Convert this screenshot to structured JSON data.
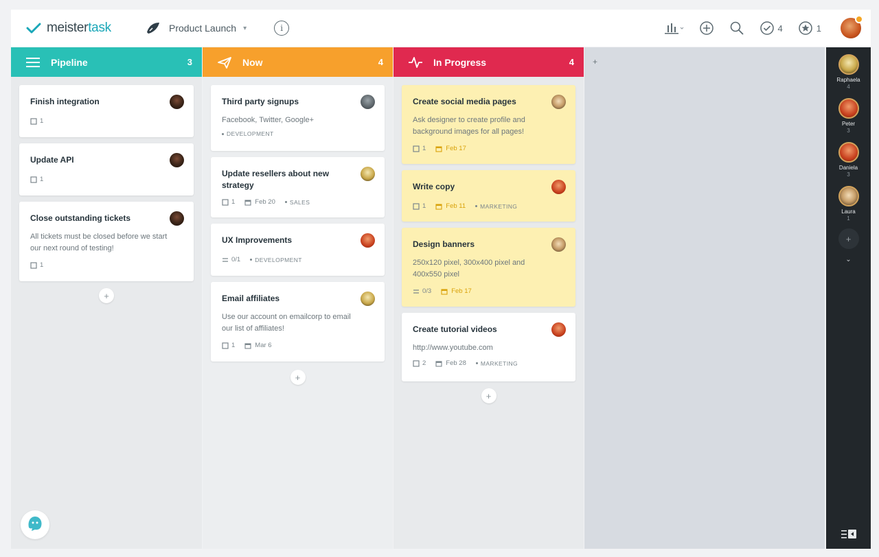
{
  "app": {
    "logo_text_1": "meister",
    "logo_text_2": "task",
    "project_name": "Product Launch",
    "info_icon": "i"
  },
  "topbar": {
    "chart_icon": "bar-chart-icon",
    "add_icon": "plus-circle-icon",
    "search_icon": "search-icon",
    "tasks_count": "4",
    "stars_count": "1"
  },
  "colors": {
    "pipeline": "#29c0b6",
    "now": "#f7a02c",
    "in_progress": "#e0294f",
    "due_date": "#d9a20a"
  },
  "columns": {
    "pipeline": {
      "title": "Pipeline",
      "count": "3",
      "cards": [
        {
          "title": "Finish integration",
          "checklist": "1"
        },
        {
          "title": "Update API",
          "checklist": "1"
        },
        {
          "title": "Close outstanding tickets",
          "desc": "All tickets must be closed before we start our next round of testing!",
          "checklist": "1"
        }
      ]
    },
    "now": {
      "title": "Now",
      "count": "4",
      "cards": [
        {
          "title": "Third party signups",
          "desc": "Facebook, Twitter, Google+",
          "tag": "DEVELOPMENT"
        },
        {
          "title": "Update resellers about new strategy",
          "checklist": "1",
          "date": "Feb 20",
          "tag": "SALES"
        },
        {
          "title": "UX Improvements",
          "checklist": "0/1",
          "tag": "DEVELOPMENT"
        },
        {
          "title": "Email affiliates",
          "desc": "Use our account on emailcorp to email our list of affiliates!",
          "checklist": "1",
          "date": "Mar 6"
        }
      ]
    },
    "in_progress": {
      "title": "In Progress",
      "count": "4",
      "cards": [
        {
          "title": "Create social media pages",
          "desc": "Ask designer to create profile and background images for all pages!",
          "checklist": "1",
          "date": "Feb 17"
        },
        {
          "title": "Write copy",
          "checklist": "1",
          "date": "Feb 11",
          "tag": "MARKETING"
        },
        {
          "title": "Design banners",
          "desc": "250x120 pixel, 300x400 pixel and 400x550 pixel",
          "checklist": "0/3",
          "date": "Feb 17"
        },
        {
          "title": "Create tutorial videos",
          "desc": "http://www.youtube.com",
          "checklist": "2",
          "date": "Feb 28",
          "tag": "MARKETING"
        }
      ]
    }
  },
  "members": [
    {
      "name": "Raphaela",
      "count": "4"
    },
    {
      "name": "Peter",
      "count": "3"
    },
    {
      "name": "Daniela",
      "count": "3"
    },
    {
      "name": "Laura",
      "count": "1"
    }
  ],
  "ui": {
    "add_symbol": "+",
    "more_symbol": "⌄"
  }
}
